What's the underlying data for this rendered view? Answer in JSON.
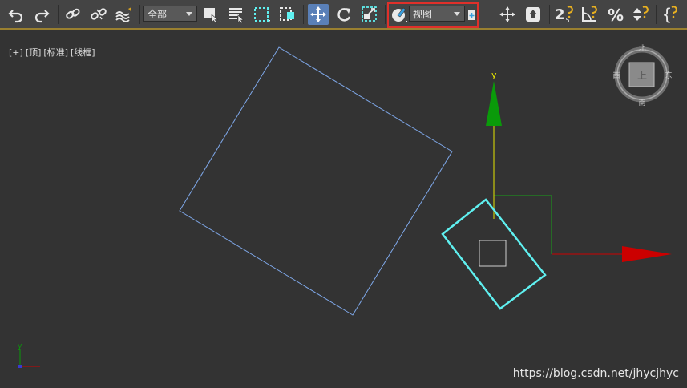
{
  "toolbar": {
    "selection_filter": "全部",
    "reference_coord_system": "视图",
    "snap_label": "2.5"
  },
  "viewport": {
    "labels": [
      "[+]",
      "[顶]",
      "[标准]",
      "[线框]"
    ],
    "gizmo_y_label": "y",
    "mini_axis_y": "y",
    "viewcube": {
      "face": "上",
      "north": "北",
      "south": "南",
      "east": "东",
      "west": "西"
    }
  },
  "watermark": "https://blog.csdn.net/jhycjhyc",
  "colors": {
    "selection_cyan": "#5ff0f0",
    "wire_blue": "#7ea7e8",
    "axis_x": "#cc0000",
    "axis_y": "#00a000",
    "axis_line_y": "#e6e600",
    "highlight_red": "#e0302a"
  }
}
